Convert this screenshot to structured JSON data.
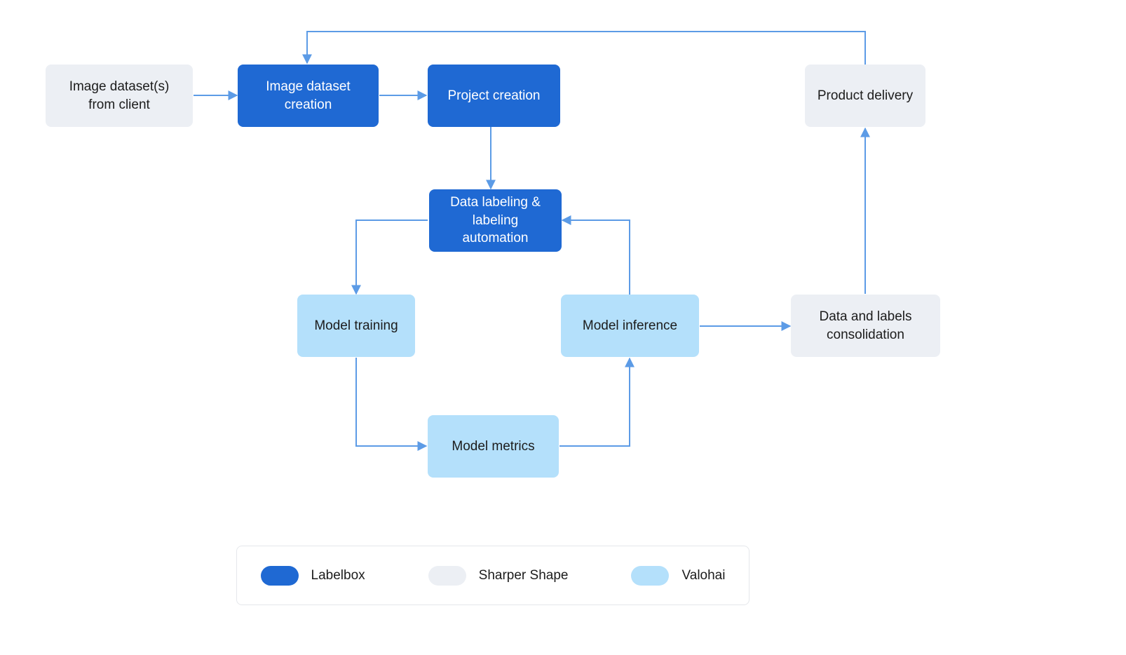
{
  "colors": {
    "labelbox": "#1f69d3",
    "sharper_shape": "#eceff4",
    "valohai": "#b4e0fb",
    "edge": "#5c9be6"
  },
  "nodes": {
    "image_dataset_from_client": {
      "label": "Image dataset(s) from client",
      "category": "sharper_shape"
    },
    "image_dataset_creation": {
      "label": "Image dataset creation",
      "category": "labelbox"
    },
    "project_creation": {
      "label": "Project creation",
      "category": "labelbox"
    },
    "data_labeling": {
      "label": "Data labeling & labeling automation",
      "category": "labelbox"
    },
    "model_training": {
      "label": "Model training",
      "category": "valohai"
    },
    "model_metrics": {
      "label": "Model metrics",
      "category": "valohai"
    },
    "model_inference": {
      "label": "Model inference",
      "category": "valohai"
    },
    "data_labels_consolidation": {
      "label": "Data and labels consolidation",
      "category": "sharper_shape"
    },
    "product_delivery": {
      "label": "Product delivery",
      "category": "sharper_shape"
    }
  },
  "edges": [
    {
      "from": "image_dataset_from_client",
      "to": "image_dataset_creation"
    },
    {
      "from": "image_dataset_creation",
      "to": "project_creation"
    },
    {
      "from": "project_creation",
      "to": "data_labeling"
    },
    {
      "from": "data_labeling",
      "to": "model_training"
    },
    {
      "from": "model_training",
      "to": "model_metrics"
    },
    {
      "from": "model_metrics",
      "to": "model_inference"
    },
    {
      "from": "model_inference",
      "to": "data_labeling"
    },
    {
      "from": "model_inference",
      "to": "data_labels_consolidation"
    },
    {
      "from": "data_labels_consolidation",
      "to": "product_delivery"
    },
    {
      "from": "product_delivery",
      "to": "image_dataset_creation"
    }
  ],
  "legend": {
    "labelbox": "Labelbox",
    "sharper_shape": "Sharper Shape",
    "valohai": "Valohai"
  }
}
